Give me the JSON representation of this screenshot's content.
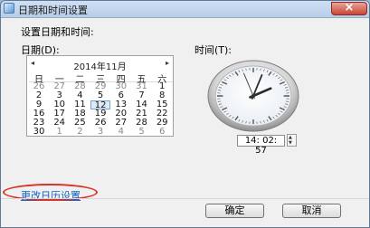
{
  "window": {
    "title": "日期和时间设置"
  },
  "prompt": "设置日期和时间:",
  "date_label": "日期(D):",
  "time_label": "时间(T):",
  "calendar": {
    "month_title": "2014年11月",
    "prev": "◂",
    "next": "▸",
    "weekdays": [
      "日",
      "一",
      "二",
      "三",
      "四",
      "五",
      "六"
    ],
    "weeks": [
      [
        "26",
        "27",
        "28",
        "29",
        "30",
        "31",
        "1"
      ],
      [
        "2",
        "3",
        "4",
        "5",
        "6",
        "7",
        "8"
      ],
      [
        "9",
        "10",
        "11",
        "12",
        "13",
        "14",
        "15"
      ],
      [
        "16",
        "17",
        "18",
        "19",
        "20",
        "21",
        "22"
      ],
      [
        "23",
        "24",
        "25",
        "26",
        "27",
        "28",
        "29"
      ],
      [
        "30",
        "1",
        "2",
        "3",
        "4",
        "5",
        "6"
      ]
    ],
    "selected": "12"
  },
  "clock": {
    "hours": 14,
    "minutes": 2,
    "seconds": 57
  },
  "time_value": "14: 02: 57",
  "link": {
    "change_calendar": "更改日历设置"
  },
  "buttons": {
    "ok": "确定",
    "cancel": "取消"
  },
  "colors": {
    "link": "#0b61c8",
    "highlight": "#d73328"
  }
}
